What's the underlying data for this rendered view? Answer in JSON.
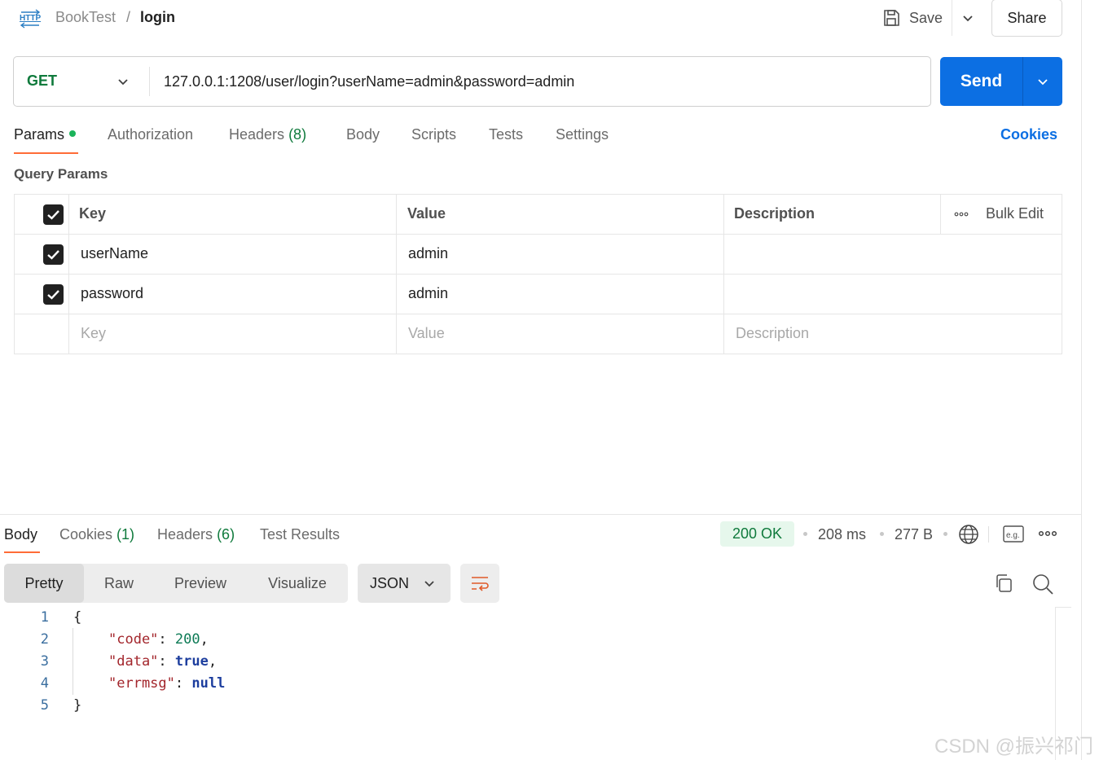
{
  "header": {
    "collection": "BookTest",
    "separator": "/",
    "request_name": "login",
    "save_label": "Save",
    "share_label": "Share",
    "http_icon": "http-icon"
  },
  "request": {
    "method": "GET",
    "url": "127.0.0.1:1208/user/login?userName=admin&password=admin",
    "send_label": "Send"
  },
  "request_tabs": [
    {
      "label": "Params",
      "active": true,
      "has_dot": true
    },
    {
      "label": "Authorization"
    },
    {
      "label": "Headers",
      "count": "(8)"
    },
    {
      "label": "Body"
    },
    {
      "label": "Scripts"
    },
    {
      "label": "Tests"
    },
    {
      "label": "Settings"
    }
  ],
  "cookies_link": "Cookies",
  "query_params": {
    "title": "Query Params",
    "headers": {
      "key": "Key",
      "value": "Value",
      "description": "Description",
      "bulk_edit": "Bulk Edit"
    },
    "rows": [
      {
        "checked": true,
        "key": "userName",
        "value": "admin",
        "description": ""
      },
      {
        "checked": true,
        "key": "password",
        "value": "admin",
        "description": ""
      }
    ],
    "placeholders": {
      "key": "Key",
      "value": "Value",
      "description": "Description"
    }
  },
  "response": {
    "tabs": [
      {
        "label": "Body",
        "active": true
      },
      {
        "label": "Cookies",
        "count": "(1)"
      },
      {
        "label": "Headers",
        "count": "(6)"
      },
      {
        "label": "Test Results"
      }
    ],
    "status": "200 OK",
    "time": "208 ms",
    "size": "277 B",
    "view_modes": [
      "Pretty",
      "Raw",
      "Preview",
      "Visualize"
    ],
    "active_view": "Pretty",
    "format": "JSON",
    "code_lines": [
      {
        "num": "1",
        "text": "{"
      },
      {
        "num": "2",
        "key": "\"code\"",
        "value": "200",
        "value_type": "num",
        "trail": ","
      },
      {
        "num": "3",
        "key": "\"data\"",
        "value": "true",
        "value_type": "kw",
        "trail": ","
      },
      {
        "num": "4",
        "key": "\"errmsg\"",
        "value": "null",
        "value_type": "kw",
        "trail": ""
      },
      {
        "num": "5",
        "text": "}"
      }
    ]
  },
  "watermark": "CSDN @振兴祁门",
  "colors": {
    "accent": "#ff6c37",
    "send_blue": "#0c6fe3",
    "method_green": "#0f7a3c",
    "status_bg": "#e6f7ec"
  }
}
